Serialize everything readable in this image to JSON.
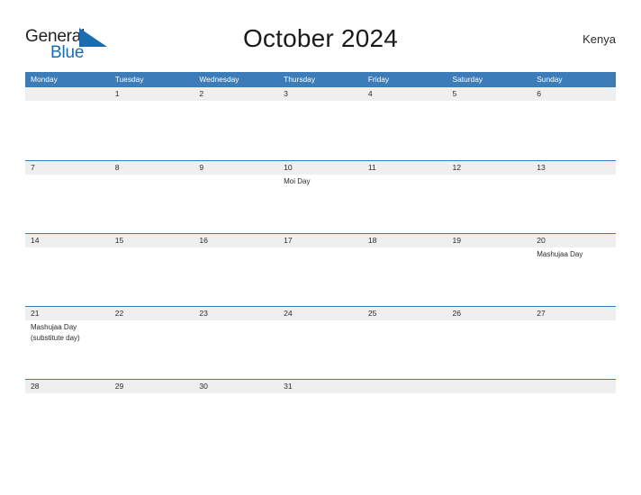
{
  "brand": {
    "name_part1": "General",
    "name_part2": "Blue",
    "flag_icon": "blue-triangle-flag-icon",
    "color_primary": "#1c6cb0",
    "color_text": "#231f20"
  },
  "header": {
    "title": "October 2024",
    "region": "Kenya"
  },
  "theme": {
    "header_blue": "#3c7cb9",
    "row_band_gray": "#efefef",
    "page_background": "#ffffff",
    "text_color": "#2b2b2b"
  },
  "calendar": {
    "month": "October",
    "year": "2024",
    "week_start": "Monday",
    "weekdays": [
      {
        "label": "Monday"
      },
      {
        "label": "Tuesday"
      },
      {
        "label": "Wednesday"
      },
      {
        "label": "Thursday"
      },
      {
        "label": "Friday"
      },
      {
        "label": "Saturday"
      },
      {
        "label": "Sunday"
      }
    ],
    "weeks": [
      {
        "days": [
          {
            "num": "",
            "events": []
          },
          {
            "num": "1",
            "events": []
          },
          {
            "num": "2",
            "events": []
          },
          {
            "num": "3",
            "events": []
          },
          {
            "num": "4",
            "events": []
          },
          {
            "num": "5",
            "events": []
          },
          {
            "num": "6",
            "events": []
          }
        ]
      },
      {
        "days": [
          {
            "num": "7",
            "events": []
          },
          {
            "num": "8",
            "events": []
          },
          {
            "num": "9",
            "events": []
          },
          {
            "num": "10",
            "events": [
              "Moi Day"
            ]
          },
          {
            "num": "11",
            "events": []
          },
          {
            "num": "12",
            "events": []
          },
          {
            "num": "13",
            "events": []
          }
        ]
      },
      {
        "days": [
          {
            "num": "14",
            "events": []
          },
          {
            "num": "15",
            "events": []
          },
          {
            "num": "16",
            "events": []
          },
          {
            "num": "17",
            "events": []
          },
          {
            "num": "18",
            "events": []
          },
          {
            "num": "19",
            "events": []
          },
          {
            "num": "20",
            "events": [
              "Mashujaa Day"
            ]
          }
        ]
      },
      {
        "days": [
          {
            "num": "21",
            "events": [
              "Mashujaa Day",
              "(substitute day)"
            ]
          },
          {
            "num": "22",
            "events": []
          },
          {
            "num": "23",
            "events": []
          },
          {
            "num": "24",
            "events": []
          },
          {
            "num": "25",
            "events": []
          },
          {
            "num": "26",
            "events": []
          },
          {
            "num": "27",
            "events": []
          }
        ]
      },
      {
        "days": [
          {
            "num": "28",
            "events": []
          },
          {
            "num": "29",
            "events": []
          },
          {
            "num": "30",
            "events": []
          },
          {
            "num": "31",
            "events": []
          },
          {
            "num": "",
            "events": []
          },
          {
            "num": "",
            "events": []
          },
          {
            "num": "",
            "events": []
          }
        ]
      }
    ]
  }
}
